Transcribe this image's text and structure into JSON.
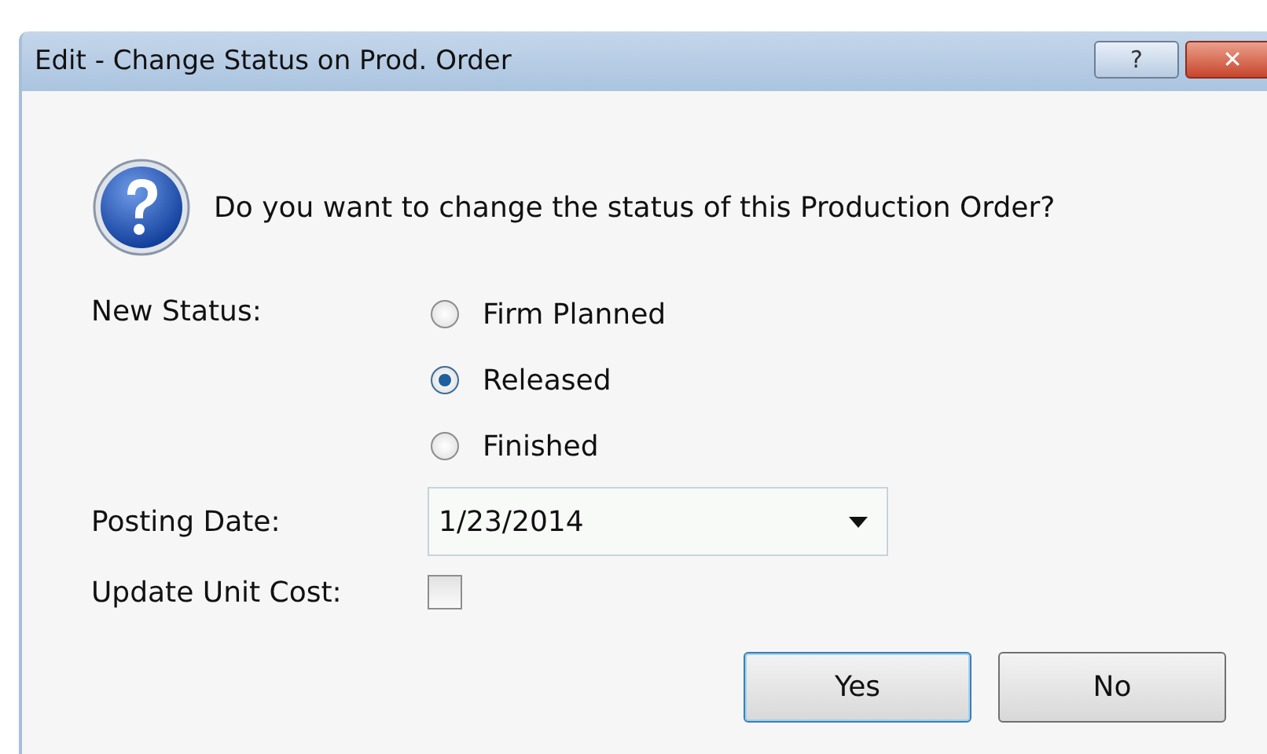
{
  "window": {
    "title": "Edit - Change Status on Prod. Order",
    "buttons": [
      {
        "kind": "help",
        "label": "?"
      },
      {
        "kind": "close",
        "label": "✕"
      }
    ]
  },
  "question": "Do you want to change the status of this Production Order?",
  "new_status": {
    "label": "New Status:",
    "options": [
      {
        "label": "Firm Planned",
        "selected": false
      },
      {
        "label": "Released",
        "selected": true
      },
      {
        "label": "Finished",
        "selected": false
      }
    ]
  },
  "posting_date": {
    "label": "Posting Date:",
    "value": "1/23/2014"
  },
  "update_unit_cost": {
    "label": "Update Unit Cost:",
    "checked": false
  },
  "buttons": [
    {
      "label": "Yes",
      "default": true
    },
    {
      "label": "No",
      "default": false
    }
  ]
}
